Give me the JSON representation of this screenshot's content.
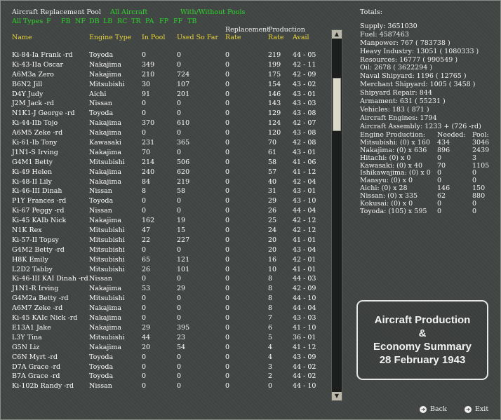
{
  "header": {
    "title": "Aircraft Replacement Pool",
    "all_aircraft": "All Aircraft",
    "with_without": "With/Without Pools"
  },
  "filters": [
    "All Types",
    "F",
    "FB",
    "NF",
    "DB",
    "LB",
    "RC",
    "TR",
    "PA",
    "FP",
    "FF",
    "TB"
  ],
  "columns": {
    "name": "Name",
    "engine": "Engine Type",
    "in_pool": "In Pool",
    "used": "Used So Far",
    "replacement_top": "Replacement",
    "replacement_bottom": "Rate",
    "production_top": "Production",
    "production_rate": "Rate",
    "production_avail": "Avail"
  },
  "rows": [
    {
      "name": "Ki-84-Ia Frank -rd",
      "engine": "Toyoda",
      "pool": "0",
      "used": "0",
      "rep": "0",
      "rate": "219",
      "avail": "44 - 05"
    },
    {
      "name": "Ki-43-IIa Oscar",
      "engine": "Nakajima",
      "pool": "349",
      "used": "0",
      "rep": "0",
      "rate": "199",
      "avail": "42 - 11"
    },
    {
      "name": "A6M3a Zero",
      "engine": "Nakajima",
      "pool": "210",
      "used": "724",
      "rep": "0",
      "rate": "175",
      "avail": "42 - 09"
    },
    {
      "name": "B6N2 Jill",
      "engine": "Mitsubishi",
      "pool": "30",
      "used": "107",
      "rep": "0",
      "rate": "154",
      "avail": "43 - 02"
    },
    {
      "name": "D4Y Judy",
      "engine": "Aichi",
      "pool": "91",
      "used": "201",
      "rep": "0",
      "rate": "146",
      "avail": "43 - 01"
    },
    {
      "name": "J2M Jack -rd",
      "engine": "Nissan",
      "pool": "0",
      "used": "0",
      "rep": "0",
      "rate": "143",
      "avail": "43 - 03"
    },
    {
      "name": "N1K1-J George -rd",
      "engine": "Toyoda",
      "pool": "0",
      "used": "0",
      "rep": "0",
      "rate": "129",
      "avail": "43 - 08"
    },
    {
      "name": "Ki-44-IIb Tojo",
      "engine": "Nakajima",
      "pool": "370",
      "used": "610",
      "rep": "0",
      "rate": "124",
      "avail": "42 - 07"
    },
    {
      "name": "A6M5 Zeke -rd",
      "engine": "Nakajima",
      "pool": "0",
      "used": "0",
      "rep": "0",
      "rate": "120",
      "avail": "43 - 08"
    },
    {
      "name": "Ki-61-Ib Tony",
      "engine": "Kawasaki",
      "pool": "231",
      "used": "365",
      "rep": "0",
      "rate": "70",
      "avail": "42 - 08"
    },
    {
      "name": "J1N1-S Irving",
      "engine": "Nakajima",
      "pool": "70",
      "used": "0",
      "rep": "0",
      "rate": "61",
      "avail": "43 - 01"
    },
    {
      "name": "G4M1 Betty",
      "engine": "Mitsubishi",
      "pool": "214",
      "used": "506",
      "rep": "0",
      "rate": "58",
      "avail": "41 - 06"
    },
    {
      "name": "Ki-49 Helen",
      "engine": "Nakajima",
      "pool": "240",
      "used": "620",
      "rep": "0",
      "rate": "57",
      "avail": "41 - 12"
    },
    {
      "name": "Ki-48-II Lily",
      "engine": "Nakajima",
      "pool": "84",
      "used": "219",
      "rep": "0",
      "rate": "40",
      "avail": "42 - 04"
    },
    {
      "name": "Ki-46-III Dinah",
      "engine": "Nissan",
      "pool": "8",
      "used": "58",
      "rep": "0",
      "rate": "31",
      "avail": "43 - 01"
    },
    {
      "name": "P1Y Frances -rd",
      "engine": "Toyoda",
      "pool": "0",
      "used": "0",
      "rep": "0",
      "rate": "29",
      "avail": "43 - 10"
    },
    {
      "name": "Ki-67 Peggy -rd",
      "engine": "Nissan",
      "pool": "0",
      "used": "0",
      "rep": "0",
      "rate": "26",
      "avail": "44 - 04"
    },
    {
      "name": "Ki-45 KAIb Nick",
      "engine": "Nakajima",
      "pool": "162",
      "used": "19",
      "rep": "0",
      "rate": "25",
      "avail": "42 - 12"
    },
    {
      "name": "N1K Rex",
      "engine": "Mitsubishi",
      "pool": "47",
      "used": "15",
      "rep": "0",
      "rate": "24",
      "avail": "42 - 12"
    },
    {
      "name": "Ki-57-II Topsy",
      "engine": "Mitsubishi",
      "pool": "22",
      "used": "227",
      "rep": "0",
      "rate": "20",
      "avail": "41 - 01"
    },
    {
      "name": "G4M2 Betty -rd",
      "engine": "Mitsubishi",
      "pool": "0",
      "used": "0",
      "rep": "0",
      "rate": "20",
      "avail": "43 - 04"
    },
    {
      "name": "H8K Emily",
      "engine": "Mitsubishi",
      "pool": "65",
      "used": "121",
      "rep": "0",
      "rate": "16",
      "avail": "42 - 01"
    },
    {
      "name": "L2D2 Tabby",
      "engine": "Mitsubishi",
      "pool": "26",
      "used": "101",
      "rep": "0",
      "rate": "10",
      "avail": "41 - 01"
    },
    {
      "name": "Ki-46-III KAI Dinah -rd",
      "engine": "Nissan",
      "pool": "0",
      "used": "0",
      "rep": "0",
      "rate": "8",
      "avail": "44 - 03"
    },
    {
      "name": "J1N1-R Irving",
      "engine": "Nakajima",
      "pool": "53",
      "used": "29",
      "rep": "0",
      "rate": "8",
      "avail": "42 - 09"
    },
    {
      "name": "G4M2a Betty -rd",
      "engine": "Mitsubishi",
      "pool": "0",
      "used": "0",
      "rep": "0",
      "rate": "8",
      "avail": "44 - 10"
    },
    {
      "name": "A6M7 Zeke -rd",
      "engine": "Nakajima",
      "pool": "0",
      "used": "0",
      "rep": "0",
      "rate": "8",
      "avail": "44 - 04"
    },
    {
      "name": "Ki-45 KAIc Nick -rd",
      "engine": "Nakajima",
      "pool": "0",
      "used": "0",
      "rep": "0",
      "rate": "7",
      "avail": "43 - 03"
    },
    {
      "name": "E13A1 Jake",
      "engine": "Nakajima",
      "pool": "29",
      "used": "395",
      "rep": "0",
      "rate": "6",
      "avail": "41 - 10"
    },
    {
      "name": "L3Y Tina",
      "engine": "Mitsubishi",
      "pool": "44",
      "used": "23",
      "rep": "0",
      "rate": "5",
      "avail": "36 - 01"
    },
    {
      "name": "G5N Liz",
      "engine": "Nakajima",
      "pool": "20",
      "used": "54",
      "rep": "0",
      "rate": "4",
      "avail": "41 - 12"
    },
    {
      "name": "C6N Myrt -rd",
      "engine": "Toyoda",
      "pool": "0",
      "used": "0",
      "rep": "0",
      "rate": "4",
      "avail": "43 - 09"
    },
    {
      "name": "D7A Grace -rd",
      "engine": "Toyoda",
      "pool": "0",
      "used": "0",
      "rep": "0",
      "rate": "3",
      "avail": "44 - 02"
    },
    {
      "name": "B7A Grace -rd",
      "engine": "Toyoda",
      "pool": "0",
      "used": "0",
      "rep": "0",
      "rate": "2",
      "avail": "44 - 02"
    },
    {
      "name": "Ki-102b Randy -rd",
      "engine": "Nissan",
      "pool": "0",
      "used": "0",
      "rep": "0",
      "rate": "0",
      "avail": "44 - 10"
    }
  ],
  "totals": {
    "lines": [
      "Totals:",
      "",
      "Supply: 3651030",
      "Fuel: 4587463",
      "Manpower: 767  ( 783738 )",
      "Heavy Industry: 13051  ( 1080333 )",
      "Resources: 16777  ( 990549 )",
      "Oil: 2678  ( 3622294 )",
      "Naval Shipyard: 1196  ( 12765 )",
      "Merchant Shipyard: 1005  ( 3458 )",
      "Shipyard Repair: 844",
      "Armament: 631  ( 55231 )",
      "Vehicles: 183  ( 871 )",
      "Aircraft Engines: 1794",
      "Aircraft Assembly: 1233 + (726 -rd)"
    ]
  },
  "engine_production": {
    "header": {
      "label": "Engine Production:",
      "needed": "Needed:",
      "pool": "Pool:"
    },
    "rows": [
      {
        "label": "Mitsubishi:  (0) x 160",
        "needed": "434",
        "pool": "3046"
      },
      {
        "label": "Nakajima:  (0) x 636",
        "needed": "896",
        "pool": "2439"
      },
      {
        "label": "Hitachi:  (0) x 0",
        "needed": "0",
        "pool": "3"
      },
      {
        "label": "Kawasaki:  (0) x 40",
        "needed": "70",
        "pool": "1105"
      },
      {
        "label": "Ishikawajima:  (0) x 0",
        "needed": "0",
        "pool": "0"
      },
      {
        "label": "Mansyu:  (0) x 0",
        "needed": "0",
        "pool": "0"
      },
      {
        "label": "Aichi:  (0) x 28",
        "needed": "146",
        "pool": "150"
      },
      {
        "label": "Nissan:  (0) x 335",
        "needed": "62",
        "pool": "880"
      },
      {
        "label": "Kokusai:  (0) x 0",
        "needed": "0",
        "pool": "0"
      },
      {
        "label": "Toyoda:  (105) x 595",
        "needed": "0",
        "pool": "0"
      }
    ]
  },
  "summary": {
    "line1": "Aircraft Production",
    "line2": "&",
    "line3": "Economy Summary",
    "line4": "28 February 1943"
  },
  "nav": {
    "back": "Back",
    "exit": "Exit"
  }
}
